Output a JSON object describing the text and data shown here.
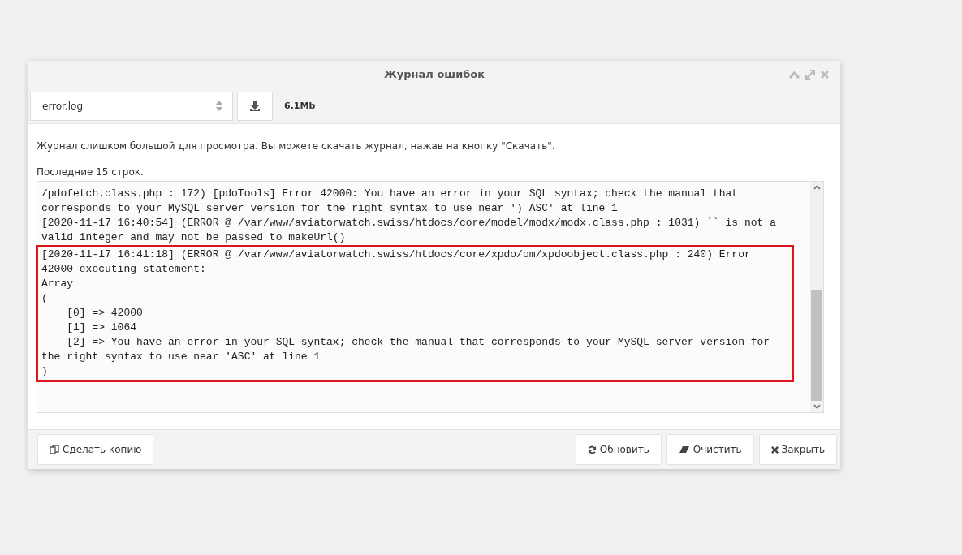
{
  "window": {
    "title": "Журнал ошибок"
  },
  "toolbar": {
    "file_select": {
      "value": "error.log"
    },
    "size": "6.1Mb"
  },
  "message": "Журнал слишком большой для просмотра. Вы можете скачать журнал, нажав на кнопку \"Скачать\".",
  "caption": "Последние 15 строк.",
  "log": {
    "lines": [
      "/pdofetch.class.php : 172) [pdoTools] Error 42000: You have an error in your SQL syntax; check the manual that",
      "corresponds to your MySQL server version for the right syntax to use near ') ASC' at line 1",
      "[2020-11-17 16:40:54] (ERROR @ /var/www/aviatorwatch.swiss/htdocs/core/model/modx/modx.class.php : 1031) `` is not a",
      "valid integer and may not be passed to makeUrl()"
    ],
    "highlighted_lines": [
      "[2020-11-17 16:41:18] (ERROR @ /var/www/aviatorwatch.swiss/htdocs/core/xpdo/om/xpdoobject.class.php : 240) Error",
      "42000 executing statement:",
      "Array",
      "(",
      "    [0] => 42000",
      "    [1] => 1064",
      "    [2] => You have an error in your SQL syntax; check the manual that corresponds to your MySQL server version for",
      "the right syntax to use near 'ASC' at line 1",
      ")"
    ]
  },
  "footer": {
    "left": [
      {
        "label": "Сделать копию",
        "kind": "copy"
      }
    ],
    "right": [
      {
        "label": "Обновить",
        "kind": "refresh"
      },
      {
        "label": "Очистить",
        "kind": "clear"
      },
      {
        "label": "Закрыть",
        "kind": "close"
      }
    ]
  }
}
